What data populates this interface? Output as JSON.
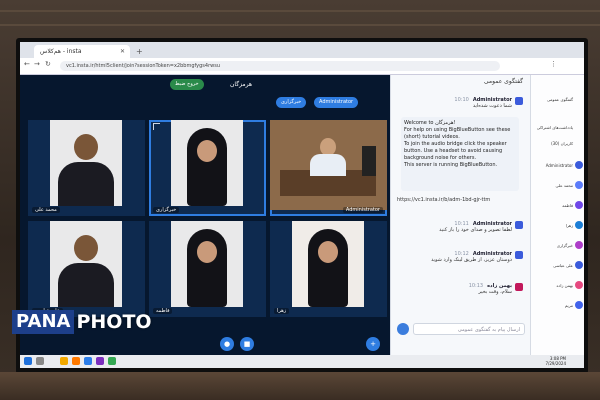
{
  "browser": {
    "tab_title": "هم‌کلاس - insta",
    "url": "vc1.insta.ir/html5client/join?sessionToken=x2bbmgfygs4rwsu"
  },
  "meeting": {
    "room_name": "هرمزگان",
    "leave_button": "خروج ضبط",
    "presenter_pill": "Administrator",
    "self_pill": "خبرگزاری"
  },
  "tiles": [
    {
      "label": "محمد علی"
    },
    {
      "label": "خبرگزاری"
    },
    {
      "label": "Administrator"
    },
    {
      "label": "علی عباسی"
    },
    {
      "label": "فاطمه"
    },
    {
      "label": "زهرا"
    }
  ],
  "chat": {
    "title": "گفتگوی عمومی",
    "messages": [
      {
        "name": "Administrator",
        "time": "10:10",
        "text": "شما دعوت شده‌اید"
      },
      {
        "name": "Administrator",
        "time": "10:11",
        "text": "لطفا تصویر و صدای خود را باز کنید"
      },
      {
        "name": "Administrator",
        "time": "10:12",
        "text": "دوستان عزیز، از طریق لینک وارد شوید"
      },
      {
        "name": "بهمن زاده",
        "time": "10:13",
        "text": "سلام، وقت بخیر"
      }
    ],
    "welcome_title": "Welcome to هرمزگان!",
    "welcome_lines": [
      "For help on using BigBlueButton see these (short) tutorial videos.",
      "To join the audio bridge click the speaker button. Use a headset to avoid causing background noise for others.",
      "This server is running BigBlueButton."
    ],
    "link_text": "https://vc1.insta.ir/b/adm-1bd-gjr-ttm",
    "input_placeholder": "ارسال پیام به گفتگوی عمومی"
  },
  "users": {
    "title": "گفتگوی عمومی",
    "notes": "یادداشت‌های اشتراکی",
    "count_label": "کاربران (30)",
    "rows": [
      "Administrator",
      "محمد علی",
      "فاطمه",
      "زهرا",
      "خبرگزاری",
      "علی عباسی",
      "بهمن زاده",
      "مریم"
    ]
  },
  "taskbar": {
    "time": "3:08 PM",
    "date": "7/29/2024"
  },
  "watermark": {
    "box": "PANA",
    "text": "PHOTO"
  },
  "colors": {
    "video_bg": "#06172e",
    "accent_blue": "#2f7de1",
    "watermark_blue": "#1d3f8a"
  }
}
